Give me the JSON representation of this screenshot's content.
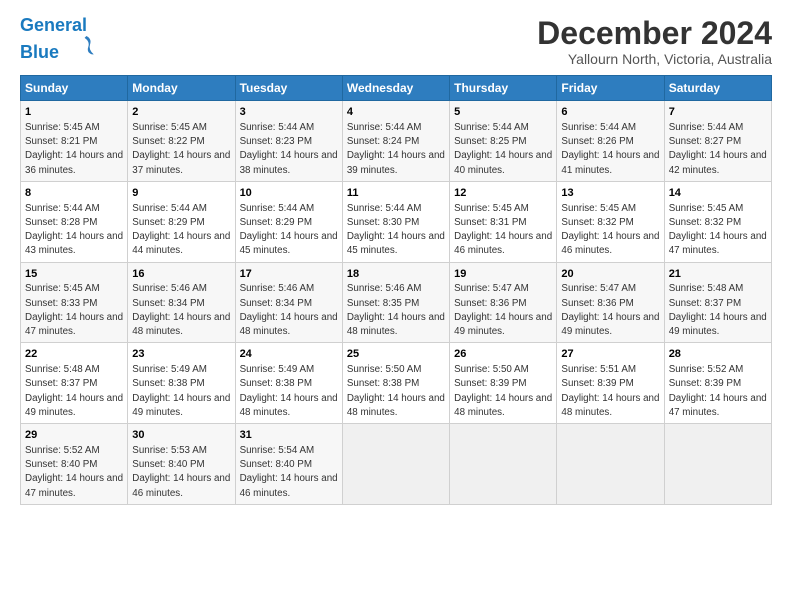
{
  "logo": {
    "text_general": "General",
    "text_blue": "Blue"
  },
  "title": "December 2024",
  "subtitle": "Yallourn North, Victoria, Australia",
  "headers": [
    "Sunday",
    "Monday",
    "Tuesday",
    "Wednesday",
    "Thursday",
    "Friday",
    "Saturday"
  ],
  "weeks": [
    [
      {
        "day": "1",
        "sunrise": "5:45 AM",
        "sunset": "8:21 PM",
        "daylight": "14 hours and 36 minutes."
      },
      {
        "day": "2",
        "sunrise": "5:45 AM",
        "sunset": "8:22 PM",
        "daylight": "14 hours and 37 minutes."
      },
      {
        "day": "3",
        "sunrise": "5:44 AM",
        "sunset": "8:23 PM",
        "daylight": "14 hours and 38 minutes."
      },
      {
        "day": "4",
        "sunrise": "5:44 AM",
        "sunset": "8:24 PM",
        "daylight": "14 hours and 39 minutes."
      },
      {
        "day": "5",
        "sunrise": "5:44 AM",
        "sunset": "8:25 PM",
        "daylight": "14 hours and 40 minutes."
      },
      {
        "day": "6",
        "sunrise": "5:44 AM",
        "sunset": "8:26 PM",
        "daylight": "14 hours and 41 minutes."
      },
      {
        "day": "7",
        "sunrise": "5:44 AM",
        "sunset": "8:27 PM",
        "daylight": "14 hours and 42 minutes."
      }
    ],
    [
      {
        "day": "8",
        "sunrise": "5:44 AM",
        "sunset": "8:28 PM",
        "daylight": "14 hours and 43 minutes."
      },
      {
        "day": "9",
        "sunrise": "5:44 AM",
        "sunset": "8:29 PM",
        "daylight": "14 hours and 44 minutes."
      },
      {
        "day": "10",
        "sunrise": "5:44 AM",
        "sunset": "8:29 PM",
        "daylight": "14 hours and 45 minutes."
      },
      {
        "day": "11",
        "sunrise": "5:44 AM",
        "sunset": "8:30 PM",
        "daylight": "14 hours and 45 minutes."
      },
      {
        "day": "12",
        "sunrise": "5:45 AM",
        "sunset": "8:31 PM",
        "daylight": "14 hours and 46 minutes."
      },
      {
        "day": "13",
        "sunrise": "5:45 AM",
        "sunset": "8:32 PM",
        "daylight": "14 hours and 46 minutes."
      },
      {
        "day": "14",
        "sunrise": "5:45 AM",
        "sunset": "8:32 PM",
        "daylight": "14 hours and 47 minutes."
      }
    ],
    [
      {
        "day": "15",
        "sunrise": "5:45 AM",
        "sunset": "8:33 PM",
        "daylight": "14 hours and 47 minutes."
      },
      {
        "day": "16",
        "sunrise": "5:46 AM",
        "sunset": "8:34 PM",
        "daylight": "14 hours and 48 minutes."
      },
      {
        "day": "17",
        "sunrise": "5:46 AM",
        "sunset": "8:34 PM",
        "daylight": "14 hours and 48 minutes."
      },
      {
        "day": "18",
        "sunrise": "5:46 AM",
        "sunset": "8:35 PM",
        "daylight": "14 hours and 48 minutes."
      },
      {
        "day": "19",
        "sunrise": "5:47 AM",
        "sunset": "8:36 PM",
        "daylight": "14 hours and 49 minutes."
      },
      {
        "day": "20",
        "sunrise": "5:47 AM",
        "sunset": "8:36 PM",
        "daylight": "14 hours and 49 minutes."
      },
      {
        "day": "21",
        "sunrise": "5:48 AM",
        "sunset": "8:37 PM",
        "daylight": "14 hours and 49 minutes."
      }
    ],
    [
      {
        "day": "22",
        "sunrise": "5:48 AM",
        "sunset": "8:37 PM",
        "daylight": "14 hours and 49 minutes."
      },
      {
        "day": "23",
        "sunrise": "5:49 AM",
        "sunset": "8:38 PM",
        "daylight": "14 hours and 49 minutes."
      },
      {
        "day": "24",
        "sunrise": "5:49 AM",
        "sunset": "8:38 PM",
        "daylight": "14 hours and 48 minutes."
      },
      {
        "day": "25",
        "sunrise": "5:50 AM",
        "sunset": "8:38 PM",
        "daylight": "14 hours and 48 minutes."
      },
      {
        "day": "26",
        "sunrise": "5:50 AM",
        "sunset": "8:39 PM",
        "daylight": "14 hours and 48 minutes."
      },
      {
        "day": "27",
        "sunrise": "5:51 AM",
        "sunset": "8:39 PM",
        "daylight": "14 hours and 48 minutes."
      },
      {
        "day": "28",
        "sunrise": "5:52 AM",
        "sunset": "8:39 PM",
        "daylight": "14 hours and 47 minutes."
      }
    ],
    [
      {
        "day": "29",
        "sunrise": "5:52 AM",
        "sunset": "8:40 PM",
        "daylight": "14 hours and 47 minutes."
      },
      {
        "day": "30",
        "sunrise": "5:53 AM",
        "sunset": "8:40 PM",
        "daylight": "14 hours and 46 minutes."
      },
      {
        "day": "31",
        "sunrise": "5:54 AM",
        "sunset": "8:40 PM",
        "daylight": "14 hours and 46 minutes."
      },
      null,
      null,
      null,
      null
    ]
  ]
}
